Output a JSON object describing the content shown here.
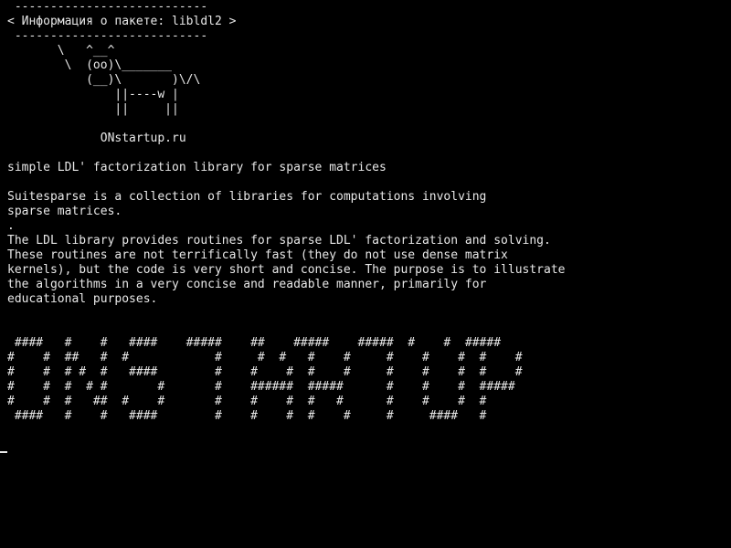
{
  "console": {
    "lines": [
      " ---------------------------",
      "< Информация о пакете: libldl2 >",
      " ---------------------------",
      "       \\   ^__^",
      "        \\  (oo)\\_______",
      "           (__)\\       )\\/\\",
      "               ||----w |",
      "               ||     ||",
      "",
      "             ONstartup.ru",
      "",
      "simple LDL' factorization library for sparse matrices",
      "",
      "Suitesparse is a collection of libraries for computations involving",
      "sparse matrices.",
      ".",
      "The LDL library provides routines for sparse LDL' factorization and solving.",
      "These routines are not terrifically fast (they do not use dense matrix",
      "kernels), but the code is very short and concise. The purpose is to illustrate",
      "the algorithms in a very concise and readable manner, primarily for",
      "educational purposes.",
      "",
      "",
      " ####   #    #   ####    #####    ##    #####    #####  #    #  #####",
      "#    #  ##   #  #            #     #  #   #    #     #    #    #  #    #",
      "#    #  # #  #   ####        #    #    #  #    #     #    #    #  #    #",
      "#    #  #  # #       #       #    ######  #####      #    #    #  #####",
      "#    #  #   ##  #    #       #    #    #  #   #      #    #    #  #",
      " ####   #    #   ####        #    #    #  #    #     #     ####   #"
    ]
  }
}
